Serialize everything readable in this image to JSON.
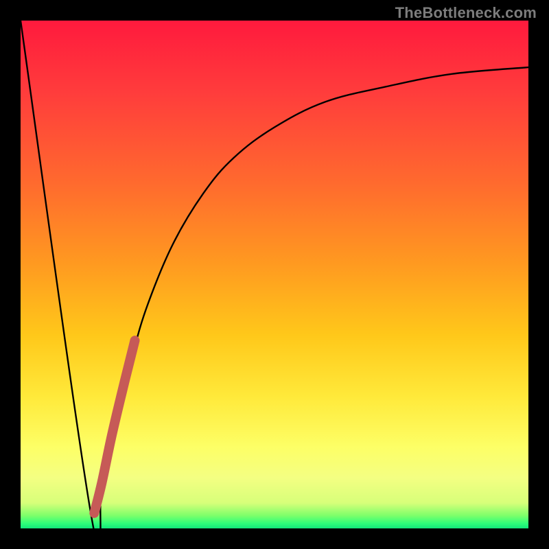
{
  "watermark": "TheBottleneck.com",
  "colors": {
    "bg": "#000000",
    "gradient_top": "#ff1a3d",
    "gradient_bottom": "#12e77a",
    "curve": "#000000",
    "highlight": "#c65a57"
  },
  "chart_data": {
    "type": "line",
    "title": "",
    "xlabel": "",
    "ylabel": "",
    "xlim": [
      0,
      1
    ],
    "ylim": [
      0,
      1
    ],
    "series": [
      {
        "name": "bottleneck-curve",
        "x": [
          0.0,
          0.14,
          0.16,
          0.19,
          0.22,
          0.25,
          0.3,
          0.36,
          0.42,
          0.5,
          0.6,
          0.72,
          0.85,
          1.0
        ],
        "values": [
          1.0,
          0.02,
          0.1,
          0.22,
          0.34,
          0.44,
          0.56,
          0.66,
          0.73,
          0.79,
          0.84,
          0.87,
          0.895,
          0.908
        ]
      },
      {
        "name": "highlight-segment",
        "x": [
          0.145,
          0.16,
          0.18,
          0.205,
          0.225
        ],
        "values": [
          0.03,
          0.09,
          0.185,
          0.29,
          0.37
        ]
      }
    ]
  }
}
